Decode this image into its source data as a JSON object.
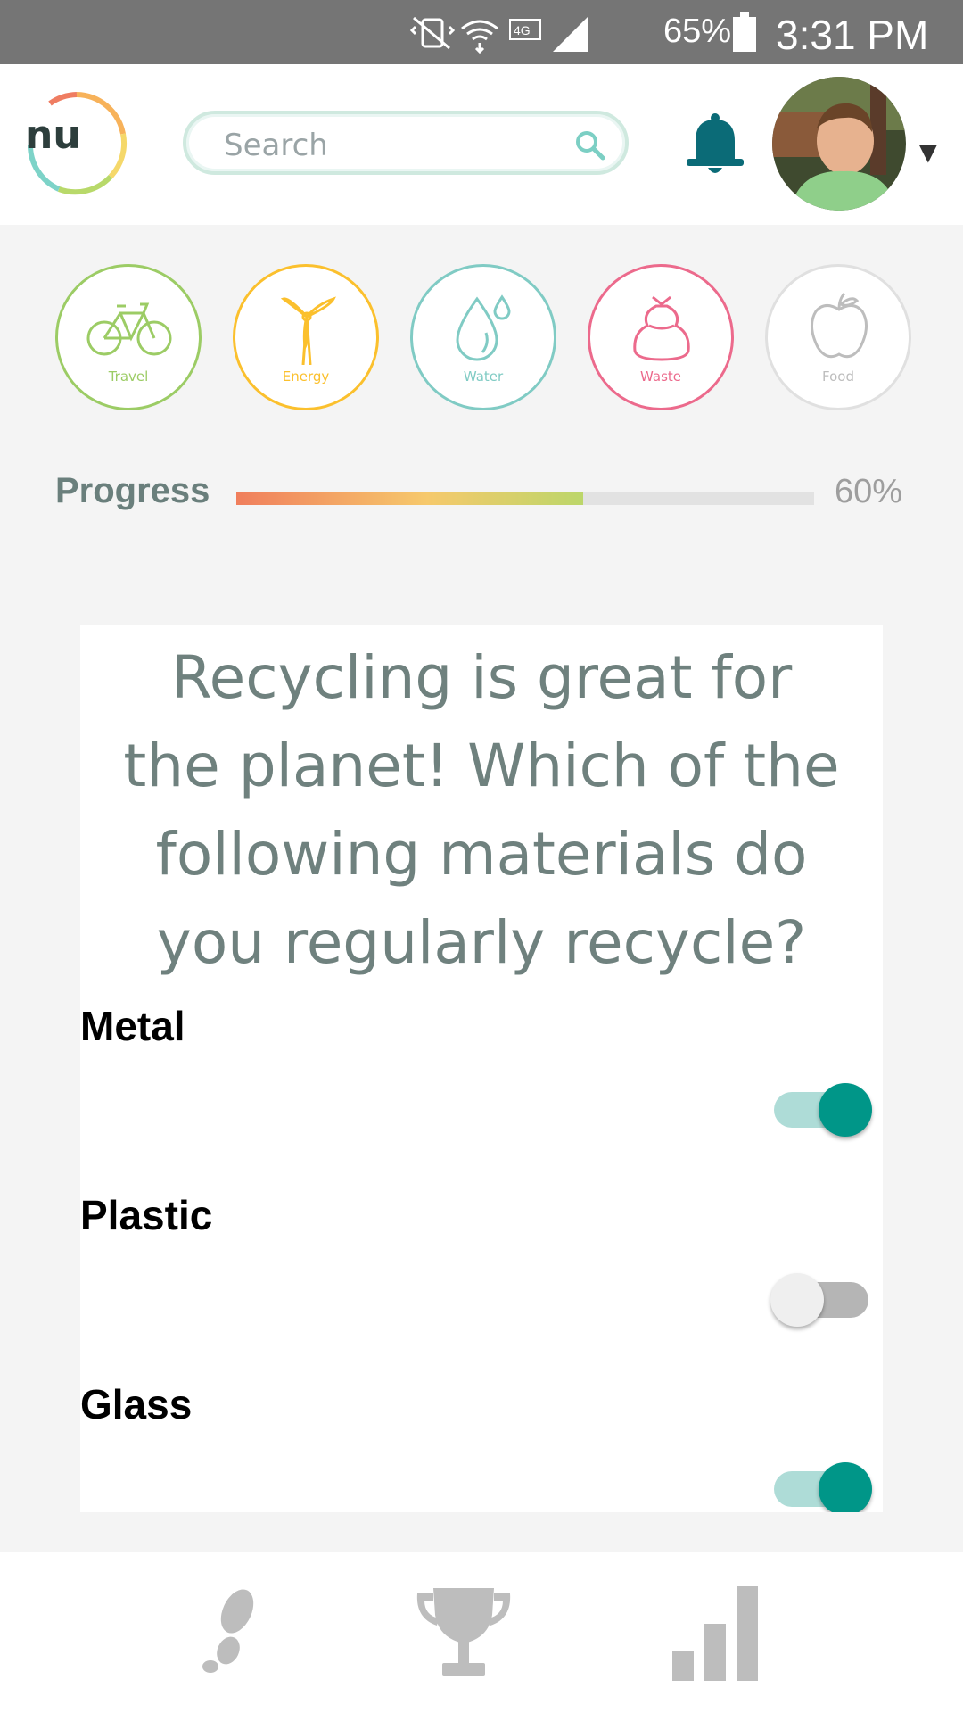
{
  "status_bar": {
    "battery_percent": "65%",
    "time": "3:31 PM",
    "icons": [
      "mute-vibrate-icon",
      "wifi-icon",
      "lte-icon",
      "signal-icon",
      "battery-icon"
    ]
  },
  "header": {
    "logo_text": "nu",
    "search": {
      "placeholder": "Search",
      "value": ""
    },
    "notification_icon": "bell-icon",
    "profile_menu_icon": "caret-down-icon"
  },
  "categories": [
    {
      "label": "Travel",
      "icon": "bicycle-icon",
      "color": "#9ccc65"
    },
    {
      "label": "Energy",
      "icon": "wind-turbine-icon",
      "color": "#fbc02d"
    },
    {
      "label": "Water",
      "icon": "water-drop-icon",
      "color": "#80cbc4"
    },
    {
      "label": "Waste",
      "icon": "trash-bag-icon",
      "color": "#ec6a8c"
    },
    {
      "label": "Food",
      "icon": "apple-icon",
      "color": "#bdbdbd"
    }
  ],
  "progress": {
    "label": "Progress",
    "value_text": "60%",
    "value": 0.6
  },
  "question": {
    "text": "Recycling is great for the planet! Which of the following materials do you regularly recycle?",
    "options": [
      {
        "label": "Metal",
        "checked": true
      },
      {
        "label": "Plastic",
        "checked": false
      },
      {
        "label": "Glass",
        "checked": true
      }
    ]
  },
  "colors": {
    "accent": "#009688",
    "accent_light": "#aedcd7",
    "bell": "#0b6b77",
    "text_muted": "#6f817e"
  },
  "bottom_nav": [
    {
      "icon": "footprints-icon"
    },
    {
      "icon": "trophy-icon"
    },
    {
      "icon": "bar-chart-icon"
    }
  ]
}
